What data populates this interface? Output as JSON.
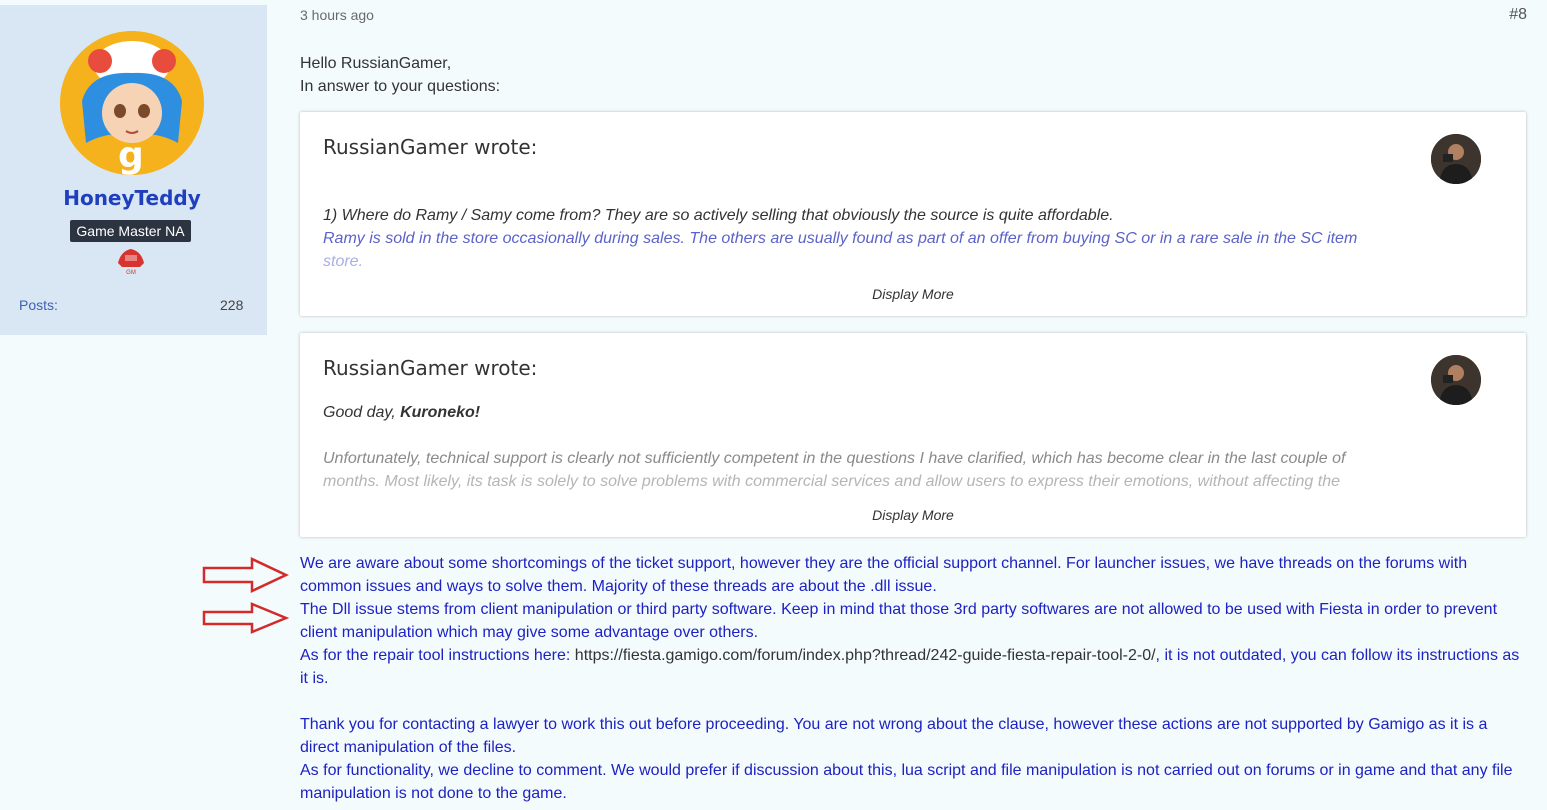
{
  "user": {
    "name": "HoneyTeddy",
    "role": "Game Master NA",
    "avatar_letter": "g",
    "posts_label": "Posts:",
    "posts_value": "228"
  },
  "post": {
    "time": "3 hours ago",
    "number": "#8",
    "greeting": "Hello RussianGamer,",
    "intro": "In answer to your questions:"
  },
  "quote1": {
    "author": "RussianGamer wrote:",
    "question": "1) Where do Ramy / Samy come from? They are so actively selling that obviously the source is quite affordable.",
    "answer_line1": "Ramy is sold in the store occasionally during sales. The others are usually found as part of an offer from buying SC or in a rare sale in the SC item",
    "answer_line2": "store.",
    "more": "Display More"
  },
  "quote2": {
    "author": "RussianGamer wrote:",
    "greeting_prefix": "Good day,",
    "greeting_name": "Kuroneko!",
    "text_line1": "Unfortunately, technical support is clearly not sufficiently competent in the questions I have clarified, which has become clear in the last couple of",
    "text_line2": "months. Most likely, its task is solely to solve problems with commercial services and allow users to express their emotions, without affecting the",
    "more": "Display More"
  },
  "reply": {
    "p1": "We are aware about some shortcomings of the ticket support, however they are the official support channel. For launcher issues, we have threads on the forums with common issues and ways to solve them. Majority of these threads are about the .dll issue.",
    "p2": "The Dll issue stems from client manipulation or third party software. Keep in mind that those 3rd party softwares are not allowed to be used with Fiesta in order to prevent client manipulation which may give some advantage over others.",
    "p3_prefix": "As for the repair tool instructions here: ",
    "p3_link": "https://fiesta.gamigo.com/forum/index.php?thread/242-guide-fiesta-repair-tool-2-0/",
    "p3_suffix": ", it is not outdated, you can follow its instructions as it is.",
    "p4": "Thank you for contacting a lawyer to work this out before proceeding. You are not wrong about the clause, however these actions are not supported by Gamigo as it is a direct manipulation of the files.",
    "p5": "As for functionality, we decline to comment. We would prefer if discussion about this, lua script and file manipulation is not carried out on forums or in game and that any file manipulation is not done to the game."
  },
  "colors": {
    "reply_text": "#1d22c2",
    "username": "#1f3fbf",
    "annotation_arrow": "#d42a2a"
  }
}
